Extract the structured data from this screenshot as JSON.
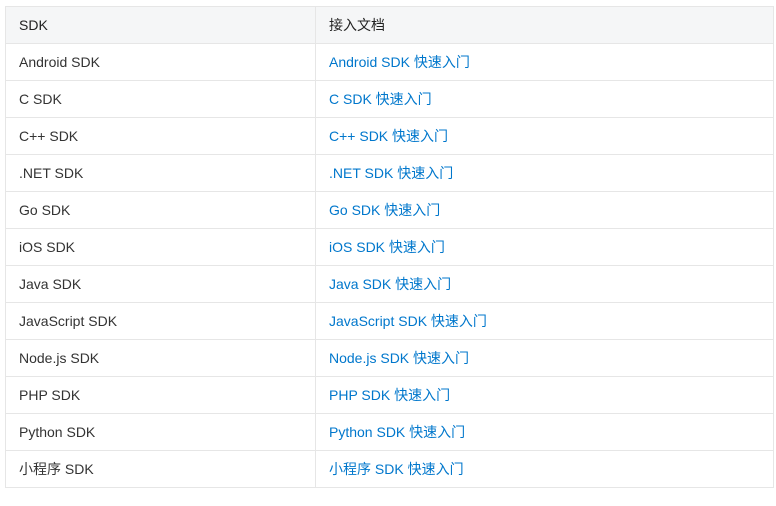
{
  "table": {
    "headers": [
      "SDK",
      "接入文档"
    ],
    "rows": [
      {
        "sdk": "Android SDK",
        "doc": "Android SDK 快速入门"
      },
      {
        "sdk": "C SDK",
        "doc": "C SDK 快速入门"
      },
      {
        "sdk": "C++ SDK",
        "doc": "C++ SDK 快速入门"
      },
      {
        "sdk": ".NET SDK",
        "doc": ".NET SDK 快速入门"
      },
      {
        "sdk": "Go SDK",
        "doc": "Go SDK 快速入门"
      },
      {
        "sdk": "iOS SDK",
        "doc": "iOS SDK 快速入门"
      },
      {
        "sdk": "Java SDK",
        "doc": "Java SDK 快速入门"
      },
      {
        "sdk": "JavaScript SDK",
        "doc": "JavaScript SDK 快速入门"
      },
      {
        "sdk": "Node.js SDK",
        "doc": "Node.js SDK 快速入门"
      },
      {
        "sdk": "PHP SDK",
        "doc": "PHP SDK 快速入门"
      },
      {
        "sdk": "Python SDK",
        "doc": "Python SDK 快速入门"
      },
      {
        "sdk": "小程序 SDK",
        "doc": "小程序 SDK 快速入门"
      }
    ]
  },
  "colors": {
    "link": "#0077cc",
    "header_bg": "#f5f6f7",
    "border": "#e6e6e6",
    "text": "#333333"
  }
}
